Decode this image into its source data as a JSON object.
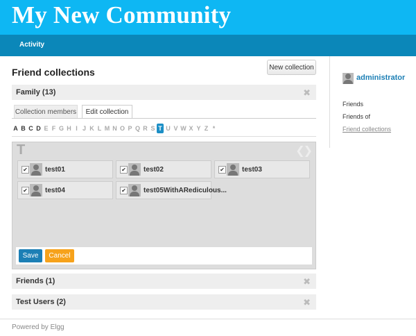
{
  "site": {
    "title": "My New Community"
  },
  "topbar": {
    "activity_label": "Activity"
  },
  "main": {
    "page_title": "Friend collections",
    "new_collection_label": "New collection",
    "collections": [
      {
        "label": "Family (13)"
      },
      {
        "label": "Friends (1)"
      },
      {
        "label": "Test Users (2)"
      }
    ],
    "tabs": [
      {
        "label": "Collection members"
      },
      {
        "label": "Edit collection"
      }
    ],
    "alphabet": [
      "A",
      "B",
      "C",
      "D",
      "E",
      "F",
      "G",
      "H",
      "I",
      "J",
      "K",
      "L",
      "M",
      "N",
      "O",
      "P",
      "Q",
      "R",
      "S",
      "T",
      "U",
      "V",
      "W",
      "X",
      "Y",
      "Z",
      "*"
    ],
    "alphabet_selected": "T",
    "panel_letter": "T",
    "members": [
      {
        "name": "test01",
        "checked": true
      },
      {
        "name": "test02",
        "checked": true
      },
      {
        "name": "test03",
        "checked": true
      },
      {
        "name": "test04",
        "checked": true
      },
      {
        "name": "test05WithARediculous...",
        "checked": true
      }
    ],
    "save_label": "Save",
    "cancel_label": "Cancel"
  },
  "sidebar": {
    "username": "administrator",
    "links": [
      {
        "label": "Friends"
      },
      {
        "label": "Friends of"
      },
      {
        "label": "Friend collections"
      }
    ]
  },
  "footer": {
    "text": "Powered by Elgg"
  }
}
